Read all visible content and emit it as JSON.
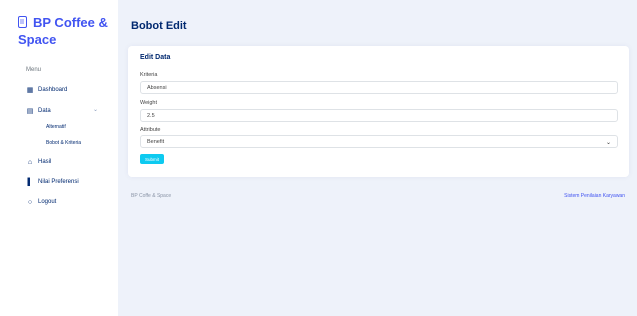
{
  "brand": {
    "name": "BP Coffee & Space"
  },
  "sidebar": {
    "heading": "Menu",
    "items": [
      {
        "label": "Dashboard",
        "icon": "grid-icon"
      },
      {
        "label": "Data",
        "icon": "document-icon"
      },
      {
        "label": "Hasil",
        "icon": "home-icon"
      },
      {
        "label": "Nilai Preferensi",
        "icon": "bar-chart-icon"
      },
      {
        "label": "Logout",
        "icon": "circle-icon"
      }
    ],
    "data_subitems": [
      "Alternatif",
      "Bobot & Kriteria"
    ]
  },
  "page": {
    "title": "Bobot Edit"
  },
  "form": {
    "title": "Edit Data",
    "kriteria_label": "Kriteria",
    "kriteria_value": "Absensi",
    "weight_label": "Weight",
    "weight_value": "2.5",
    "attribute_label": "Attribute",
    "attribute_value": "Benefit",
    "submit_label": "Submit"
  },
  "footer": {
    "left": "BP Coffe & Space",
    "right": "Sistem Penilaian Karyawan"
  }
}
